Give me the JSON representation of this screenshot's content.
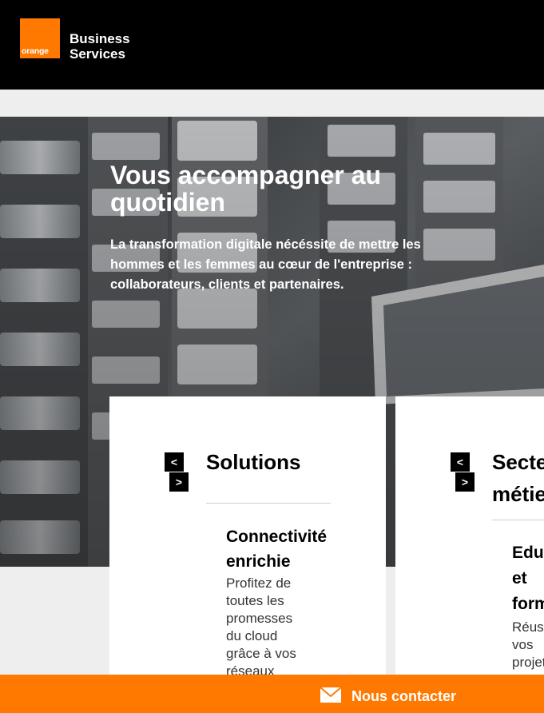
{
  "header": {
    "logo_text": "orange",
    "brand_line1": "Business",
    "brand_line2": "Services"
  },
  "hero": {
    "title": "Vous accompagner au quotidien",
    "text": "La transformation digitale nécéssite de mettre les hommes et les femmes au cœur de l'entreprise : collaborateurs, clients et partenaires."
  },
  "cards": [
    {
      "prev_label": "<",
      "next_label": ">",
      "title": "Solutions",
      "item_title_line1": "Connectivité",
      "item_title_line2": "enrichie",
      "item_text": "Profitez de toutes les promesses du cloud grâce à vos réseaux"
    },
    {
      "prev_label": "<",
      "next_label": ">",
      "title_line1": "Secteurs",
      "title_line2": "métiers",
      "item_title_line1": "Education",
      "item_title_line2": "et",
      "item_title_line3": "formation",
      "item_text": "Réussir vos projets éducatifs"
    }
  ],
  "contact": {
    "label": "Nous contacter",
    "icon": "mail-icon"
  },
  "colors": {
    "brand_orange": "#ff7900",
    "header_bg": "#000000",
    "page_bg": "#eeeeee"
  }
}
